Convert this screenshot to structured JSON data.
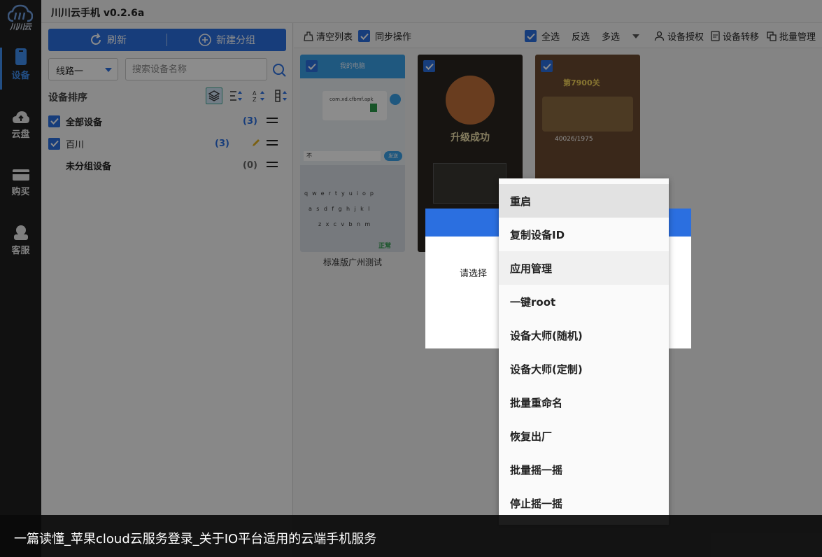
{
  "app": {
    "title": "川川云手机 v0.2.6a",
    "logo_text": "川川云"
  },
  "nav": [
    {
      "label": "设备",
      "icon": "phone-icon",
      "active": true
    },
    {
      "label": "云盘",
      "icon": "cloud-upload-icon",
      "active": false
    },
    {
      "label": "购买",
      "icon": "card-icon",
      "active": false
    },
    {
      "label": "客服",
      "icon": "headset-icon",
      "active": false
    }
  ],
  "left": {
    "refresh_label": "刷新",
    "new_group_label": "新建分组",
    "line_select": "线路一",
    "search_placeholder": "搜索设备名称",
    "sort_label": "设备排序",
    "groups": [
      {
        "name": "全部设备",
        "count": "(3)",
        "checked": true
      },
      {
        "name": "百川",
        "count": "(3)",
        "checked": true
      },
      {
        "name": "未分组设备",
        "count": "(0)",
        "checked": false
      }
    ]
  },
  "toolbar": {
    "clear_list": "清空列表",
    "sync_op": "同步操作",
    "select_all": "全选",
    "invert": "反选",
    "multi": "多选",
    "authorize": "设备授权",
    "transfer": "设备转移",
    "batch_manage": "批量管理"
  },
  "devices": [
    {
      "label": "标准版广州测试"
    },
    {
      "label": ""
    },
    {
      "label": ""
    }
  ],
  "device_screens": {
    "d1": {
      "top_title": "我的电脑",
      "file": "com.xd.cfbmf.apk",
      "input_char": "不",
      "send": "发送",
      "keys_row1": "qwertyuiop",
      "keys_row2": "asdfghjkl",
      "keys_row3": "zxcvbnm",
      "status": "正常"
    },
    "d2": {
      "banner": "升级成功"
    },
    "d3": {
      "level": "第7900关",
      "score": "40026/1975"
    }
  },
  "dialog": {
    "prompt": "请选择"
  },
  "context_menu": [
    "重启",
    "复制设备ID",
    "应用管理",
    "一键root",
    "设备大师(随机)",
    "设备大师(定制)",
    "批量重命名",
    "恢复出厂",
    "批量摇一摇",
    "停止摇一摇"
  ],
  "caption": "一篇读懂_苹果cloud云服务登录_关于IO平台适用的云端手机服务",
  "colors": {
    "accent": "#2b6fe0",
    "rail_bg": "#1f1f1f",
    "active_nav": "#3f8ef0"
  }
}
